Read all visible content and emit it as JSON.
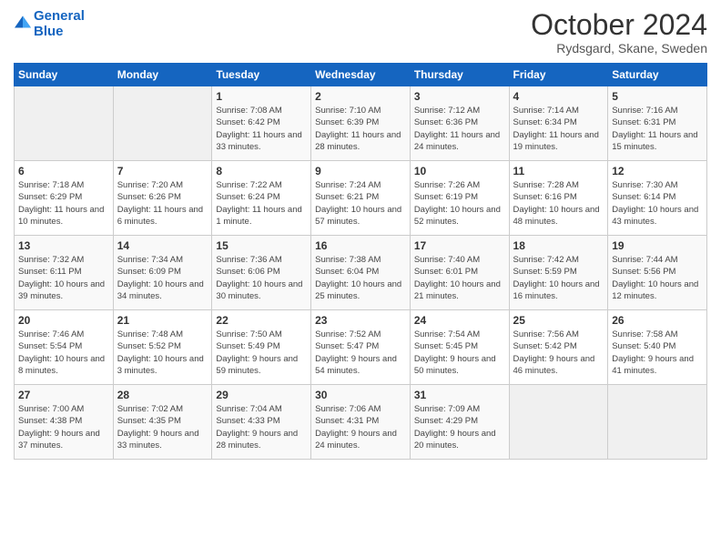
{
  "header": {
    "logo_line1": "General",
    "logo_line2": "Blue",
    "month": "October 2024",
    "location": "Rydsgard, Skane, Sweden"
  },
  "weekdays": [
    "Sunday",
    "Monday",
    "Tuesday",
    "Wednesday",
    "Thursday",
    "Friday",
    "Saturday"
  ],
  "weeks": [
    [
      {
        "day": "",
        "sunrise": "",
        "sunset": "",
        "daylight": ""
      },
      {
        "day": "",
        "sunrise": "",
        "sunset": "",
        "daylight": ""
      },
      {
        "day": "1",
        "sunrise": "Sunrise: 7:08 AM",
        "sunset": "Sunset: 6:42 PM",
        "daylight": "Daylight: 11 hours and 33 minutes."
      },
      {
        "day": "2",
        "sunrise": "Sunrise: 7:10 AM",
        "sunset": "Sunset: 6:39 PM",
        "daylight": "Daylight: 11 hours and 28 minutes."
      },
      {
        "day": "3",
        "sunrise": "Sunrise: 7:12 AM",
        "sunset": "Sunset: 6:36 PM",
        "daylight": "Daylight: 11 hours and 24 minutes."
      },
      {
        "day": "4",
        "sunrise": "Sunrise: 7:14 AM",
        "sunset": "Sunset: 6:34 PM",
        "daylight": "Daylight: 11 hours and 19 minutes."
      },
      {
        "day": "5",
        "sunrise": "Sunrise: 7:16 AM",
        "sunset": "Sunset: 6:31 PM",
        "daylight": "Daylight: 11 hours and 15 minutes."
      }
    ],
    [
      {
        "day": "6",
        "sunrise": "Sunrise: 7:18 AM",
        "sunset": "Sunset: 6:29 PM",
        "daylight": "Daylight: 11 hours and 10 minutes."
      },
      {
        "day": "7",
        "sunrise": "Sunrise: 7:20 AM",
        "sunset": "Sunset: 6:26 PM",
        "daylight": "Daylight: 11 hours and 6 minutes."
      },
      {
        "day": "8",
        "sunrise": "Sunrise: 7:22 AM",
        "sunset": "Sunset: 6:24 PM",
        "daylight": "Daylight: 11 hours and 1 minute."
      },
      {
        "day": "9",
        "sunrise": "Sunrise: 7:24 AM",
        "sunset": "Sunset: 6:21 PM",
        "daylight": "Daylight: 10 hours and 57 minutes."
      },
      {
        "day": "10",
        "sunrise": "Sunrise: 7:26 AM",
        "sunset": "Sunset: 6:19 PM",
        "daylight": "Daylight: 10 hours and 52 minutes."
      },
      {
        "day": "11",
        "sunrise": "Sunrise: 7:28 AM",
        "sunset": "Sunset: 6:16 PM",
        "daylight": "Daylight: 10 hours and 48 minutes."
      },
      {
        "day": "12",
        "sunrise": "Sunrise: 7:30 AM",
        "sunset": "Sunset: 6:14 PM",
        "daylight": "Daylight: 10 hours and 43 minutes."
      }
    ],
    [
      {
        "day": "13",
        "sunrise": "Sunrise: 7:32 AM",
        "sunset": "Sunset: 6:11 PM",
        "daylight": "Daylight: 10 hours and 39 minutes."
      },
      {
        "day": "14",
        "sunrise": "Sunrise: 7:34 AM",
        "sunset": "Sunset: 6:09 PM",
        "daylight": "Daylight: 10 hours and 34 minutes."
      },
      {
        "day": "15",
        "sunrise": "Sunrise: 7:36 AM",
        "sunset": "Sunset: 6:06 PM",
        "daylight": "Daylight: 10 hours and 30 minutes."
      },
      {
        "day": "16",
        "sunrise": "Sunrise: 7:38 AM",
        "sunset": "Sunset: 6:04 PM",
        "daylight": "Daylight: 10 hours and 25 minutes."
      },
      {
        "day": "17",
        "sunrise": "Sunrise: 7:40 AM",
        "sunset": "Sunset: 6:01 PM",
        "daylight": "Daylight: 10 hours and 21 minutes."
      },
      {
        "day": "18",
        "sunrise": "Sunrise: 7:42 AM",
        "sunset": "Sunset: 5:59 PM",
        "daylight": "Daylight: 10 hours and 16 minutes."
      },
      {
        "day": "19",
        "sunrise": "Sunrise: 7:44 AM",
        "sunset": "Sunset: 5:56 PM",
        "daylight": "Daylight: 10 hours and 12 minutes."
      }
    ],
    [
      {
        "day": "20",
        "sunrise": "Sunrise: 7:46 AM",
        "sunset": "Sunset: 5:54 PM",
        "daylight": "Daylight: 10 hours and 8 minutes."
      },
      {
        "day": "21",
        "sunrise": "Sunrise: 7:48 AM",
        "sunset": "Sunset: 5:52 PM",
        "daylight": "Daylight: 10 hours and 3 minutes."
      },
      {
        "day": "22",
        "sunrise": "Sunrise: 7:50 AM",
        "sunset": "Sunset: 5:49 PM",
        "daylight": "Daylight: 9 hours and 59 minutes."
      },
      {
        "day": "23",
        "sunrise": "Sunrise: 7:52 AM",
        "sunset": "Sunset: 5:47 PM",
        "daylight": "Daylight: 9 hours and 54 minutes."
      },
      {
        "day": "24",
        "sunrise": "Sunrise: 7:54 AM",
        "sunset": "Sunset: 5:45 PM",
        "daylight": "Daylight: 9 hours and 50 minutes."
      },
      {
        "day": "25",
        "sunrise": "Sunrise: 7:56 AM",
        "sunset": "Sunset: 5:42 PM",
        "daylight": "Daylight: 9 hours and 46 minutes."
      },
      {
        "day": "26",
        "sunrise": "Sunrise: 7:58 AM",
        "sunset": "Sunset: 5:40 PM",
        "daylight": "Daylight: 9 hours and 41 minutes."
      }
    ],
    [
      {
        "day": "27",
        "sunrise": "Sunrise: 7:00 AM",
        "sunset": "Sunset: 4:38 PM",
        "daylight": "Daylight: 9 hours and 37 minutes."
      },
      {
        "day": "28",
        "sunrise": "Sunrise: 7:02 AM",
        "sunset": "Sunset: 4:35 PM",
        "daylight": "Daylight: 9 hours and 33 minutes."
      },
      {
        "day": "29",
        "sunrise": "Sunrise: 7:04 AM",
        "sunset": "Sunset: 4:33 PM",
        "daylight": "Daylight: 9 hours and 28 minutes."
      },
      {
        "day": "30",
        "sunrise": "Sunrise: 7:06 AM",
        "sunset": "Sunset: 4:31 PM",
        "daylight": "Daylight: 9 hours and 24 minutes."
      },
      {
        "day": "31",
        "sunrise": "Sunrise: 7:09 AM",
        "sunset": "Sunset: 4:29 PM",
        "daylight": "Daylight: 9 hours and 20 minutes."
      },
      {
        "day": "",
        "sunrise": "",
        "sunset": "",
        "daylight": ""
      },
      {
        "day": "",
        "sunrise": "",
        "sunset": "",
        "daylight": ""
      }
    ]
  ]
}
